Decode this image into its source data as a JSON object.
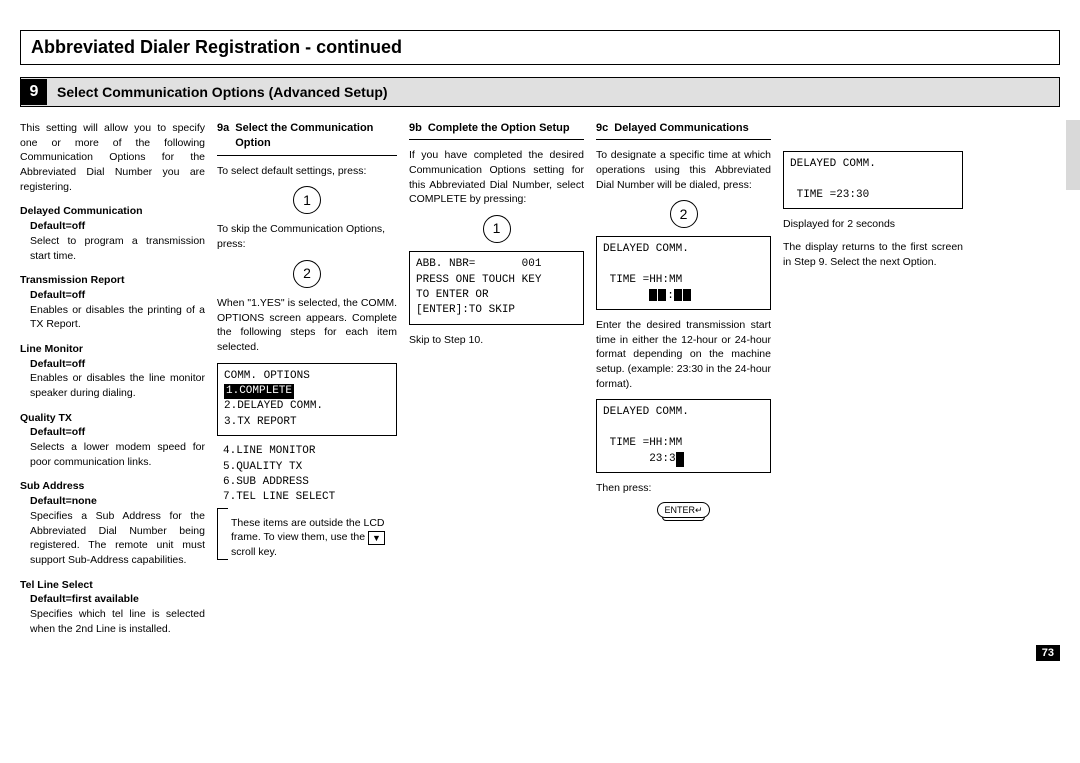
{
  "title": "Abbreviated Dialer Registration - continued",
  "step9": {
    "num": "9",
    "title": "Select Communication Options (Advanced Setup)"
  },
  "intro": "This setting will allow you to specify one or more of the following Communication Options for the Abbreviated Dial Number you are registering.",
  "defs": [
    {
      "title": "Delayed Communication",
      "sub": "Default=off",
      "desc": "Select to program a transmission start time."
    },
    {
      "title": "Transmission Report",
      "sub": "Default=off",
      "desc": "Enables or disables the printing of a TX Report."
    },
    {
      "title": "Line Monitor",
      "sub": "Default=off",
      "desc": "Enables or disables the line monitor speaker during dialing."
    },
    {
      "title": "Quality TX",
      "sub": "Default=off",
      "desc": "Selects a lower modem speed for poor communication links."
    },
    {
      "title": "Sub Address",
      "sub": "Default=none",
      "desc": "Specifies a Sub Address for the Abbreviated Dial Number being registered. The remote unit must support Sub-Address capabilities."
    },
    {
      "title": "Tel Line Select",
      "sub": "Default=first available",
      "desc": "Specifies which tel line is selected when the 2nd Line is installed."
    }
  ],
  "s9a": {
    "num": "9a",
    "title": "Select the Communication Option",
    "p1": "To select default settings, press:",
    "key1": "1",
    "p2": "To skip the Communication Options, press:",
    "key2": "2",
    "p3": "When \"1.YES\" is selected, the COMM. OPTIONS screen appears. Complete the following steps for each item selected.",
    "lcd_top": "COMM. OPTIONS",
    "lcd_inv": "1.COMPLETE",
    "lcd_l2": "2.DELAYED COMM.",
    "lcd_l3": "3.TX REPORT",
    "lcd_extra": "4.LINE MONITOR\n5.QUALITY TX\n6.SUB ADDRESS\n7.TEL LINE SELECT",
    "note": "These items are outside the LCD frame. To view them, use the       scroll key.",
    "scroll": "▼"
  },
  "s9b": {
    "num": "9b",
    "title": "Complete the Option Setup",
    "p1": "If you have completed the desired Communication Options setting for this Abbreviated Dial Number, select COMPLETE by pressing:",
    "key1": "1",
    "lcd": "ABB. NBR=       001\nPRESS ONE TOUCH KEY\nTO ENTER OR\n[ENTER]:TO SKIP",
    "p2": "Skip to Step 10."
  },
  "s9c": {
    "num": "9c",
    "title": "Delayed Communications",
    "p1": "To designate a specific time at which operations using this Abbreviated Dial Number will be dialed, press:",
    "key1": "2",
    "lcd1_l1": "DELAYED COMM.",
    "lcd1_l2": " TIME =HH:MM",
    "p2": "Enter the desired transmission start time in either the 12-hour or 24-hour format depending on the machine setup. (example: 23:30 in the 24-hour format).",
    "lcd2_l1": "DELAYED COMM.",
    "lcd2_l2": " TIME =HH:MM",
    "lcd2_l3": "       23:3",
    "p3": "Then press:",
    "enter": "ENTER↵"
  },
  "s9c_right": {
    "lcd_l1": "DELAYED COMM.",
    "lcd_l2": " TIME =23:30",
    "p1": "Displayed for 2 seconds",
    "p2": "The display returns to the first screen in Step 9. Select the next Option."
  },
  "page_number": "73"
}
